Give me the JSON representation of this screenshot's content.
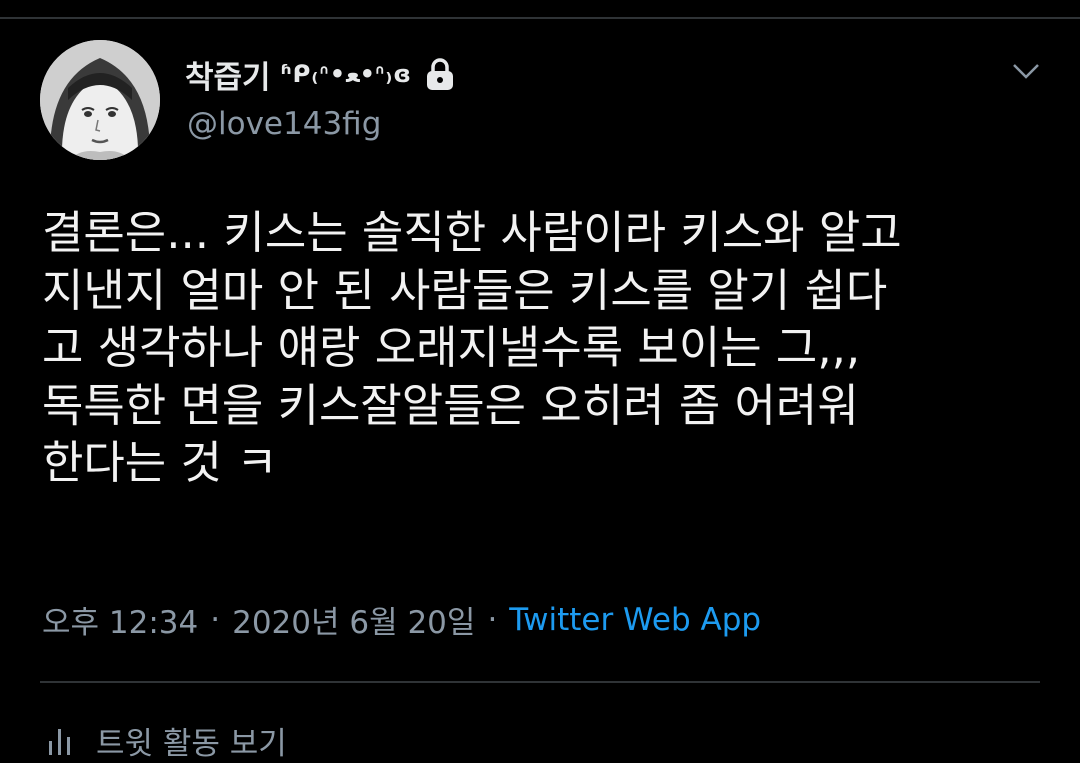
{
  "tweet": {
    "author": {
      "display_name": "착즙기",
      "display_name_decoration": "ʱᑭ₍ᐢ•ﻌ•ᐢ₎ɞ",
      "handle": "@love143fig",
      "protected_icon": "lock-icon"
    },
    "menu_icon": "chevron-down-icon",
    "text_lines": [
      "결론은... 키스는 솔직한 사람이라 키스와 알고",
      "지낸지 얼마 안 된 사람들은 키스를 알기 쉽다",
      "고 생각하나 얘랑 오래지낼수록 보이는 그,,,",
      "독특한 면을 키스잘알들은 오히려 좀 어려워",
      "한다는 것 ㅋ"
    ],
    "time": "오후 12:34",
    "date": "2020년 6월 20일",
    "separator": "·",
    "source": "Twitter Web App",
    "activity_label": "트윗 활동 보기",
    "activity_icon": "bar-chart-icon"
  },
  "colors": {
    "background": "#000000",
    "text": "#e7e9ea",
    "secondary_text": "#8b98a5",
    "link": "#1d9bf0",
    "divider": "#2f3336"
  }
}
